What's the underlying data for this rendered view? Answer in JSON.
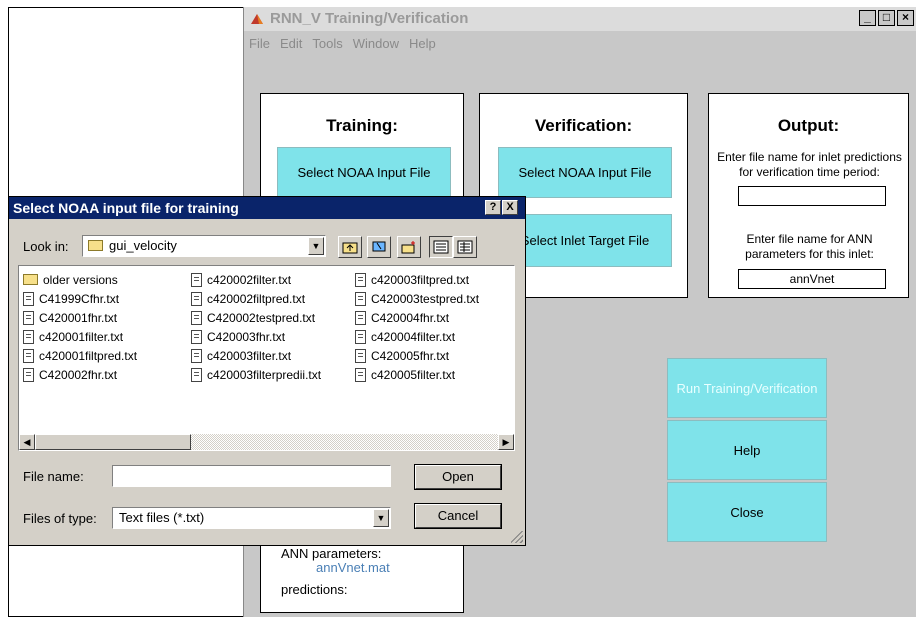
{
  "main_window": {
    "title": "RNN_V Training/Verification",
    "menu": [
      "File",
      "Edit",
      "Tools",
      "Window",
      "Help"
    ],
    "training": {
      "title": "Training:",
      "select_input_label": "Select NOAA Input File",
      "ann_params_label": "ANN parameters:",
      "ann_params_value": "annVnet.mat",
      "predictions_label": "predictions:"
    },
    "verification": {
      "title": "Verification:",
      "select_input_label": "Select NOAA Input File",
      "select_target_label": "Select Inlet Target File"
    },
    "output": {
      "title": "Output:",
      "predictions_prompt": "Enter file name for inlet predictions for verification time period:",
      "predictions_value": "",
      "ann_prompt": "Enter file name for ANN parameters for this inlet:",
      "ann_value": "annVnet"
    },
    "run_button": "Run Training/Verification",
    "help_button": "Help",
    "close_button": "Close",
    "colors": {
      "button_cyan": "#7fe3ea",
      "window_bg": "#c8c8c8"
    }
  },
  "dialog": {
    "title": "Select NOAA input file for training",
    "help_btn": "?",
    "close_btn": "X",
    "look_in_label": "Look in:",
    "look_in_value": "gui_velocity",
    "files_col1": [
      "older versions",
      "C41999Cfhr.txt",
      "C420001fhr.txt",
      "c420001filter.txt",
      "c420001filtpred.txt",
      "C420002fhr.txt"
    ],
    "files_col2": [
      "c420002filter.txt",
      "c420002filtpred.txt",
      "C420002testpred.txt",
      "C420003fhr.txt",
      "c420003filter.txt",
      "c420003filterpredii.txt"
    ],
    "files_col3": [
      "c420003filtpred.txt",
      "C420003testpred.txt",
      "C420004fhr.txt",
      "c420004filter.txt",
      "C420005fhr.txt",
      "c420005filter.txt"
    ],
    "file_name_label": "File name:",
    "file_name_value": "",
    "files_of_type_label": "Files of type:",
    "files_of_type_value": "Text files (*.txt)",
    "open_button": "Open",
    "cancel_button": "Cancel",
    "colors": {
      "titlebar": "#0a246a",
      "face": "#d4d0c8"
    }
  }
}
